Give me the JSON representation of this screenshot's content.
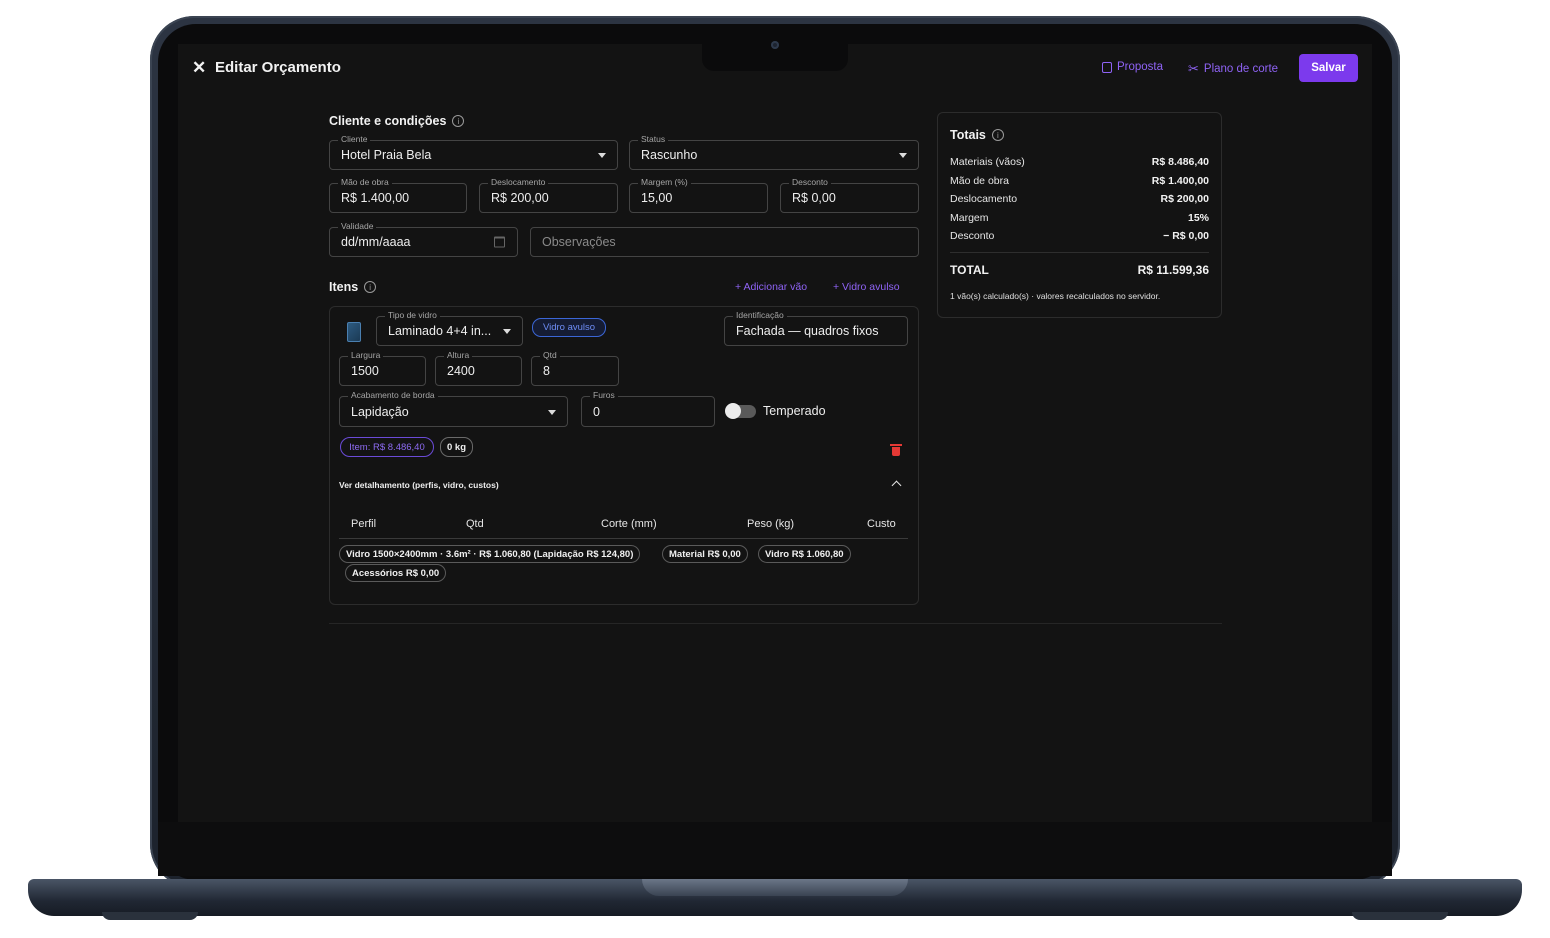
{
  "header": {
    "title": "Editar Orçamento",
    "proposal_label": "Proposta",
    "cut_plan_label": "Plano de corte",
    "save_label": "Salvar"
  },
  "client_section": {
    "title": "Cliente e condições",
    "client": {
      "label": "Cliente",
      "value": "Hotel Praia Bela"
    },
    "status": {
      "label": "Status",
      "value": "Rascunho"
    },
    "labor": {
      "label": "Mão de obra",
      "value": "R$ 1.400,00"
    },
    "travel": {
      "label": "Deslocamento",
      "value": "R$ 200,00"
    },
    "margin": {
      "label": "Margem (%)",
      "value": "15,00"
    },
    "discount": {
      "label": "Desconto",
      "value": "R$ 0,00"
    },
    "validity": {
      "label": "Validade",
      "value": "dd/mm/aaaa"
    },
    "notes": {
      "placeholder": "Observações"
    }
  },
  "items_section": {
    "title": "Itens",
    "add_opening_label": "+ Adicionar vão",
    "add_glass_label": "+ Vidro avulso",
    "item": {
      "glass_type": {
        "label": "Tipo de vidro",
        "value": "Laminado 4+4 in..."
      },
      "loose_glass_badge": "Vidro avulso",
      "identification": {
        "label": "Identificação",
        "value": "Fachada — quadros fixos"
      },
      "width": {
        "label": "Largura",
        "value": "1500"
      },
      "height": {
        "label": "Altura",
        "value": "2400"
      },
      "qty": {
        "label": "Qtd",
        "value": "8"
      },
      "edge_finish": {
        "label": "Acabamento de borda",
        "value": "Lapidação"
      },
      "holes": {
        "label": "Furos",
        "value": "0"
      },
      "tempered_label": "Temperado",
      "tempered_on": false,
      "item_total_badge": "Item: R$ 8.486,40",
      "weight_badge": "0 kg",
      "details_label": "Ver detalhamento (perfis, vidro, custos)",
      "table_headers": [
        "Perfil",
        "Qtd",
        "Corte (mm)",
        "Peso (kg)",
        "Custo"
      ],
      "chips": [
        "Vidro 1500×2400mm · 3.6m² · R$ 1.060,80 (Lapidação R$ 124,80)",
        "Material R$ 0,00",
        "Vidro R$ 1.060,80",
        "Acessórios R$ 0,00"
      ]
    }
  },
  "totals": {
    "title": "Totais",
    "rows": [
      {
        "label": "Materiais (vãos)",
        "value": "R$ 8.486,40"
      },
      {
        "label": "Mão de obra",
        "value": "R$ 1.400,00"
      },
      {
        "label": "Deslocamento",
        "value": "R$ 200,00"
      },
      {
        "label": "Margem",
        "value": "15%"
      },
      {
        "label": "Desconto",
        "value": "− R$ 0,00"
      }
    ],
    "total_label": "TOTAL",
    "total_value": "R$ 11.599,36",
    "footnote": "1 vão(s) calculado(s) · valores recalculados no servidor."
  },
  "colors": {
    "accent": "#7c3aed",
    "danger": "#e53935",
    "background": "#131313"
  }
}
